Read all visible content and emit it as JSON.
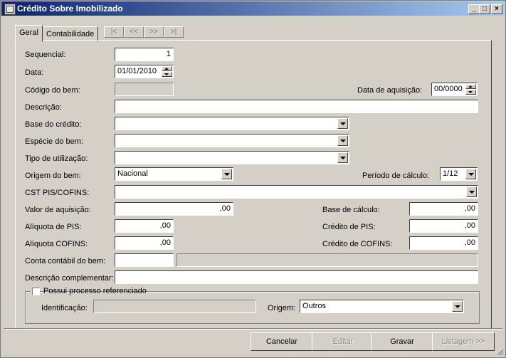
{
  "window": {
    "title": "Crédito Sobre Imobilizado"
  },
  "titlebar_buttons": {
    "minimize": "_",
    "maximize": "□",
    "close": "×"
  },
  "tabs": [
    {
      "label": "Geral"
    },
    {
      "label": "Contabilidade"
    }
  ],
  "nav": {
    "first": "|<",
    "prev": "<<",
    "next": ">>",
    "last": ">|"
  },
  "fields": {
    "sequencial": {
      "label": "Sequencial:",
      "value": "1"
    },
    "data": {
      "label": "Data:",
      "value": "01/01/2010"
    },
    "codigo_bem": {
      "label": "Código do bem:",
      "value": ""
    },
    "data_aquisicao": {
      "label": "Data de aquisição:",
      "value": "00/0000"
    },
    "descricao": {
      "label": "Descrição:",
      "value": ""
    },
    "base_credito": {
      "label": "Base do crédito:",
      "value": ""
    },
    "especie_bem": {
      "label": "Espécie do bem:",
      "value": ""
    },
    "tipo_utilizacao": {
      "label": "Tipo de utilização:",
      "value": ""
    },
    "origem_bem": {
      "label": "Origem do bem:",
      "value": "Nacional"
    },
    "periodo_calculo": {
      "label": "Período de cálculo:",
      "value": "1/12"
    },
    "cst_pis_cofins": {
      "label": "CST PIS/COFINS:",
      "value": ""
    },
    "valor_aquisicao": {
      "label": "Valor de aquisição:",
      "value": ",00"
    },
    "base_calculo": {
      "label": "Base de cálculo:",
      "value": ",00"
    },
    "aliquota_pis": {
      "label": "Alíquota de PIS:",
      "value": ",00"
    },
    "credito_pis": {
      "label": "Crédito de PIS:",
      "value": ",00"
    },
    "aliquota_cofins": {
      "label": "Alíquota COFINS:",
      "value": ",00"
    },
    "credito_cofins": {
      "label": "Crédito de COFINS:",
      "value": ",00"
    },
    "conta_contabil": {
      "label": "Conta contábil do bem:",
      "value": "",
      "description": ""
    },
    "descricao_complementar": {
      "label": "Descrição complementar:",
      "value": ""
    }
  },
  "processo": {
    "checkbox_label": "Possui processo referenciado",
    "checked": false,
    "identificacao": {
      "label": "Identificação:",
      "value": ""
    },
    "origem": {
      "label": "Origem:",
      "value": "Outros"
    }
  },
  "buttons": {
    "cancelar": "Cancelar",
    "editar": "Editar",
    "gravar": "Gravar",
    "listagem": "Listagem >>"
  }
}
